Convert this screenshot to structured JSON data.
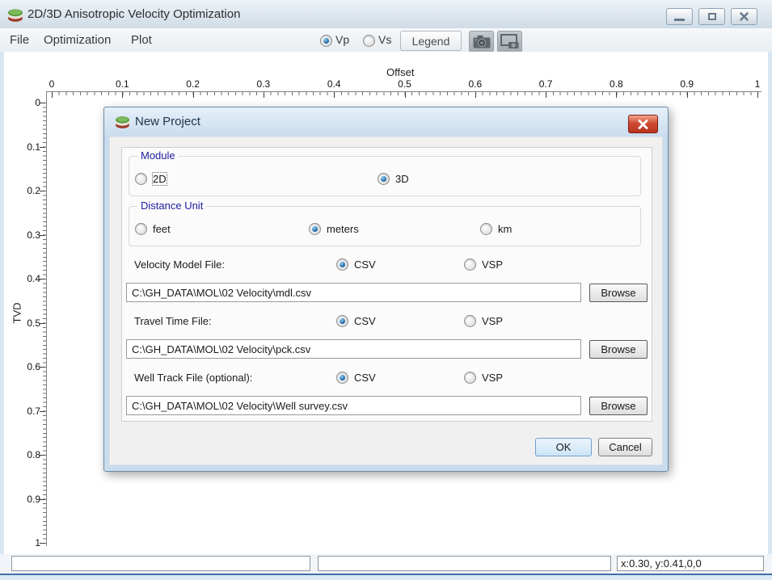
{
  "window": {
    "title": "2D/3D Anisotropic Velocity Optimization"
  },
  "menu": {
    "items": [
      {
        "label": "File"
      },
      {
        "label": "Optimization"
      },
      {
        "label": "Plot"
      }
    ]
  },
  "toolbar": {
    "vp": {
      "label": "Vp",
      "selected": true
    },
    "vs": {
      "label": "Vs",
      "selected": false
    },
    "legend_label": "Legend",
    "icons": [
      "camera-icon",
      "screen-capture-icon"
    ]
  },
  "plot": {
    "x_axis": {
      "title": "Offset",
      "ticks": [
        "0",
        "0.1",
        "0.2",
        "0.3",
        "0.4",
        "0.5",
        "0.6",
        "0.7",
        "0.8",
        "0.9",
        "1"
      ]
    },
    "y_axis": {
      "title": "TVD",
      "ticks": [
        "0",
        "0.1",
        "0.2",
        "0.3",
        "0.4",
        "0.5",
        "0.6",
        "0.7",
        "0.8",
        "0.9",
        "1"
      ]
    }
  },
  "dialog": {
    "title": "New Project",
    "module_group": {
      "label": "Module",
      "options": [
        {
          "label": "2D",
          "selected": false
        },
        {
          "label": "3D",
          "selected": true
        }
      ]
    },
    "distance_group": {
      "label": "Distance Unit",
      "options": [
        {
          "label": "feet",
          "selected": false
        },
        {
          "label": "meters",
          "selected": true
        },
        {
          "label": "km",
          "selected": false
        }
      ]
    },
    "browse_label": "Browse",
    "file_rows": [
      {
        "label": "Velocity Model File:",
        "csv_label": "CSV",
        "vsp_label": "VSP",
        "csv_selected": true,
        "vsp_selected": false,
        "path": "C:\\GH_DATA\\MOL\\02 Velocity\\mdl.csv"
      },
      {
        "label": "Travel Time File:",
        "csv_label": "CSV",
        "vsp_label": "VSP",
        "csv_selected": true,
        "vsp_selected": false,
        "path": "C:\\GH_DATA\\MOL\\02 Velocity\\pck.csv"
      },
      {
        "label": "Well Track File (optional):",
        "csv_label": "CSV",
        "vsp_label": "VSP",
        "csv_selected": true,
        "vsp_selected": false,
        "path": "C:\\GH_DATA\\MOL\\02 Velocity\\Well survey.csv"
      }
    ],
    "ok_label": "OK",
    "cancel_label": "Cancel"
  },
  "status_bar": {
    "field1": "",
    "field2": "",
    "coords": "x:0.30, y:0.41,0,0"
  },
  "colors": {
    "accent_blue": "#15599c",
    "group_label_blue": "#2020a0",
    "close_red": "#c8402e"
  }
}
